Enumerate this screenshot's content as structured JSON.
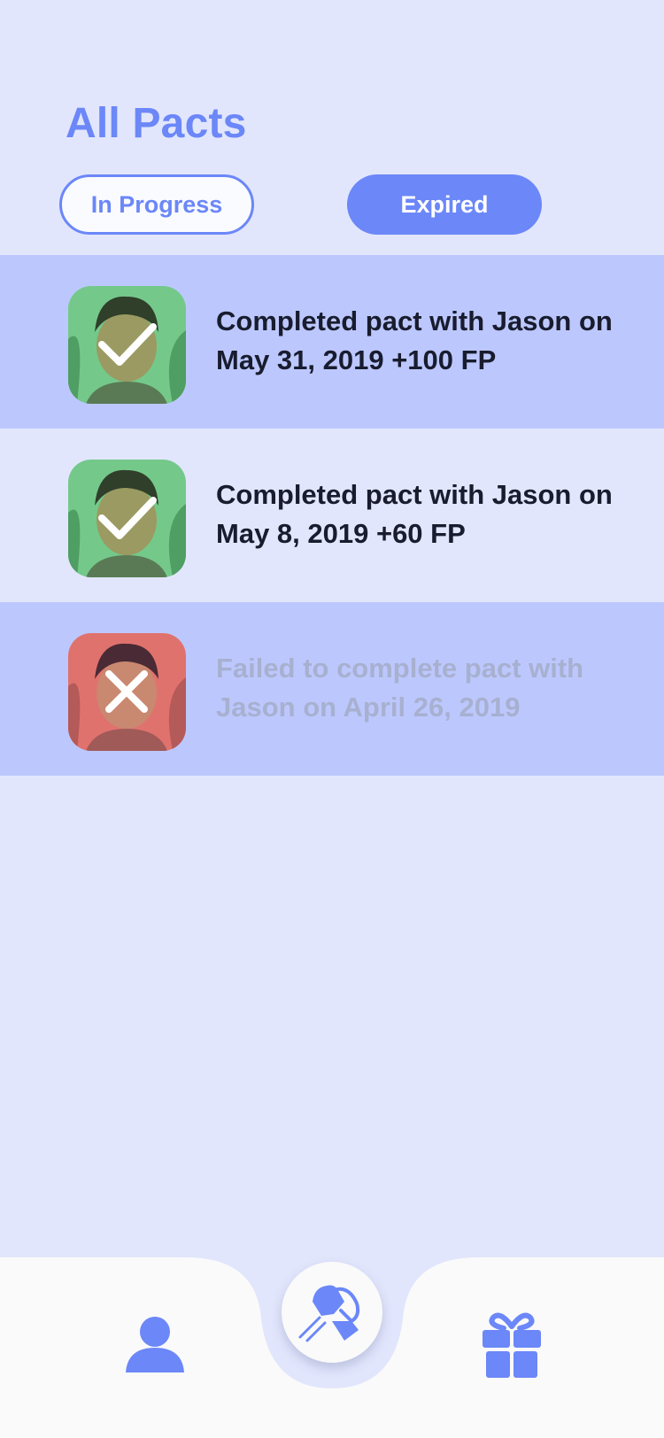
{
  "header": {
    "title": "All Pacts"
  },
  "tabs": {
    "in_progress": "In Progress",
    "expired": "Expired",
    "active": "Expired"
  },
  "pacts": [
    {
      "text": "Completed pact with Jason on May 31, 2019 +100 FP",
      "status": "completed"
    },
    {
      "text": "Completed pact with Jason on May 8, 2019 +60 FP",
      "status": "completed"
    },
    {
      "text": "Failed to complete pact with Jason on April 26, 2019",
      "status": "failed"
    }
  ],
  "nav": {
    "items": [
      {
        "icon": "person-icon"
      },
      {
        "icon": "handshake-icon"
      },
      {
        "icon": "gift-icon"
      }
    ]
  },
  "colors": {
    "accent": "#6b87f8",
    "background": "#e2e6fc",
    "row_highlight": "#bcc8fd",
    "completed_overlay": "#7ee8a0",
    "failed_overlay": "#f07a7a",
    "failed_text": "#a8b0d0"
  }
}
